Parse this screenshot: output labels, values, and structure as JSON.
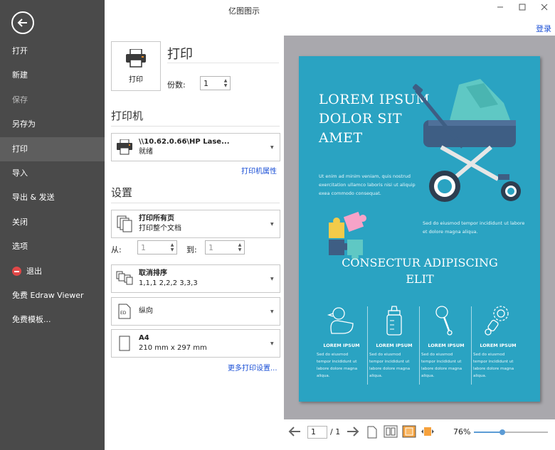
{
  "app": {
    "title": "亿图图示",
    "login": "登录"
  },
  "sidebar": {
    "items": [
      {
        "label": "打开",
        "state": "normal"
      },
      {
        "label": "新建",
        "state": "normal"
      },
      {
        "label": "保存",
        "state": "disabled"
      },
      {
        "label": "另存为",
        "state": "normal"
      },
      {
        "label": "打印",
        "state": "active"
      },
      {
        "label": "导入",
        "state": "normal"
      },
      {
        "label": "导出 & 发送",
        "state": "normal"
      },
      {
        "label": "关闭",
        "state": "normal"
      },
      {
        "label": "选项",
        "state": "normal"
      },
      {
        "label": "退出",
        "state": "exit"
      },
      {
        "label": "免费 Edraw Viewer",
        "state": "normal"
      },
      {
        "label": "免费模板...",
        "state": "normal"
      }
    ]
  },
  "print": {
    "button_label": "打印",
    "heading": "打印",
    "copies_label": "份数:",
    "copies_value": "1"
  },
  "printer": {
    "section_title": "打印机",
    "name": "\\\\10.62.0.66\\HP Lase...",
    "status": "就绪",
    "properties_link": "打印机属性"
  },
  "settings": {
    "section_title": "设置",
    "range_main": "打印所有页",
    "range_sub": "打印整个文档",
    "from_label": "从:",
    "from_value": "1",
    "to_label": "到:",
    "to_value": "1",
    "collate_main": "取消排序",
    "collate_sub": "1,1,1   2,2,2   3,3,3",
    "orientation": "纵向",
    "paper_main": "A4",
    "paper_sub": "210 mm x 297 mm",
    "more_link": "更多打印设置..."
  },
  "preview": {
    "hero_title": [
      "LOREM IPSUM",
      "DOLOR SIT",
      "AMET"
    ],
    "para1": [
      "Ut enim ad minim veniam, quis nostrud",
      "exercitation ullamco laboris nisi ut aliquip",
      "exea commodo consequat."
    ],
    "para2": [
      "Sed do eiusmod tempor incididunt ut labore",
      "et dolore magna aliqua."
    ],
    "sub_title": [
      "CONSECTUR ADIPISCING",
      "ELIT"
    ],
    "columns": [
      {
        "icon": "duck-icon",
        "caption": "LOREM IPSUM",
        "text": [
          "Sed do eiusmod",
          "tempor incididunt ut",
          "labore dolore magna",
          "aliqua."
        ]
      },
      {
        "icon": "bottle-icon",
        "caption": "LOREM IPSUM",
        "text": [
          "Sed do eiusmod",
          "tempor incididunt ut",
          "labore dolore magna",
          "aliqua."
        ]
      },
      {
        "icon": "rattle-icon",
        "caption": "LOREM IPSUM",
        "text": [
          "Sed do eiusmod",
          "tempor incididunt ut",
          "labore dolore magna",
          "aliqua."
        ]
      },
      {
        "icon": "teether-icon",
        "caption": "LOREM IPSUM",
        "text": [
          "Sed do eiusmod",
          "tempor incididunt ut",
          "labore dolore magna",
          "aliqua."
        ]
      }
    ]
  },
  "pager": {
    "current_page": "1",
    "total": "/ 1",
    "zoom": "76%",
    "zoom_fraction": 0.38
  },
  "colors": {
    "sidebar": "#4a4a4a",
    "page": "#2aa3c2",
    "preview_bg": "#a9a8ad",
    "link": "#1a4fd6"
  }
}
